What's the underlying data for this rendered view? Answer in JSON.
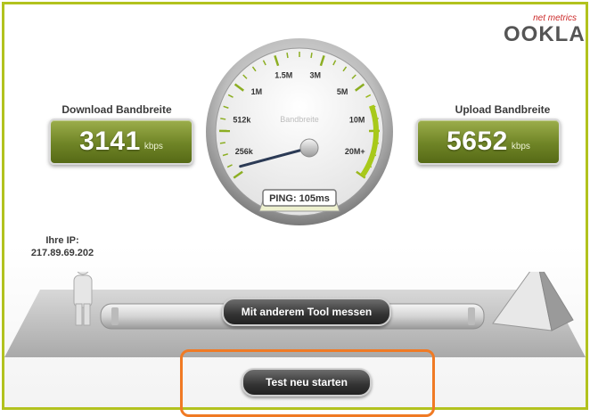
{
  "logo": {
    "brand": "OOKLA",
    "sub": "net metrics"
  },
  "download": {
    "label": "Download Bandbreite",
    "value": "3141",
    "unit": "kbps"
  },
  "upload": {
    "label": "Upload Bandbreite",
    "value": "5652",
    "unit": "kbps"
  },
  "gauge": {
    "title": "Bandbreite",
    "ticks": [
      "256k",
      "512k",
      "1M",
      "1.5M",
      "3M",
      "5M",
      "10M",
      "20M+"
    ],
    "ping": "PING: 105ms",
    "needle_position_fraction": 0.08
  },
  "ip": {
    "label": "Ihre IP:",
    "address": "217.89.69.202"
  },
  "buttons": {
    "other_tool": "Mit anderem Tool messen",
    "restart": "Test neu starten"
  },
  "colors": {
    "accent": "#b2c21e",
    "box_green": "#6f8426",
    "highlight": "#f07a24"
  }
}
